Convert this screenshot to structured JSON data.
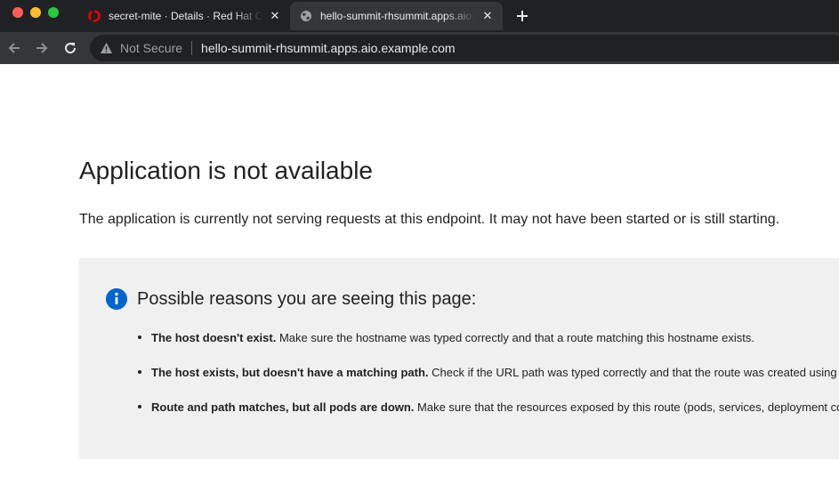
{
  "browser": {
    "tabs": [
      {
        "title": "secret-mite · Details · Red Hat OpenShift",
        "favicon": "openshift-icon",
        "active": false
      },
      {
        "title": "hello-summit-rhsummit.apps.aio.example.com",
        "favicon": "globe-icon",
        "active": true
      }
    ],
    "address_bar": {
      "security_label": "Not Secure",
      "url": "hello-summit-rhsummit.apps.aio.example.com"
    }
  },
  "page": {
    "title": "Application is not available",
    "lead": "The application is currently not serving requests at this endpoint. It may not have been started or is still starting.",
    "reasons_box": {
      "title": "Possible reasons you are seeing this page:",
      "items": [
        {
          "strong": "The host doesn't exist.",
          "text": " Make sure the hostname was typed correctly and that a route matching this hostname exists."
        },
        {
          "strong": "The host exists, but doesn't have a matching path.",
          "text": " Check if the URL path was typed correctly and that the route was created using the desired path."
        },
        {
          "strong": "Route and path matches, but all pods are down.",
          "text": " Make sure that the resources exposed by this route (pods, services, deployment configs, etc) have at least one pod running."
        }
      ]
    }
  },
  "colors": {
    "chrome_dark": "#202124",
    "toolbar": "#35363a",
    "info_blue": "#0066cc",
    "alert_bg": "#f0f0f0",
    "openshift_red": "#ee0000"
  }
}
